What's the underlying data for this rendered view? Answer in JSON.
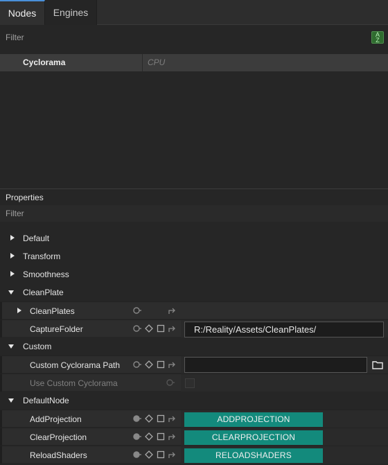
{
  "tabs": [
    {
      "label": "Nodes",
      "active": true
    },
    {
      "label": "Engines",
      "active": false
    }
  ],
  "nodes_filter": {
    "placeholder": "Filter"
  },
  "sort_icon": {
    "top": "A",
    "bottom": "Z"
  },
  "nodes": [
    {
      "name": "Cyclorama",
      "device": "CPU"
    }
  ],
  "properties": {
    "title": "Properties",
    "filter_placeholder": "Filter",
    "items": [
      {
        "label": "Default",
        "state": "collapsed"
      },
      {
        "label": "Transform",
        "state": "collapsed"
      },
      {
        "label": "Smoothness",
        "state": "collapsed"
      },
      {
        "label": "CleanPlate",
        "state": "expanded"
      },
      {
        "label": "CleanPlates",
        "state": "collapsed"
      },
      {
        "label": "CaptureFolder",
        "value": "R:/Reality/Assets/CleanPlates/"
      },
      {
        "label": "Custom",
        "state": "expanded"
      },
      {
        "label": "Custom Cyclorama Path",
        "value": ""
      },
      {
        "label": "Use Custom Cyclorama",
        "enabled": false,
        "checked": false
      },
      {
        "label": "DefaultNode",
        "state": "expanded"
      },
      {
        "label": "AddProjection",
        "button": "ADDPROJECTION"
      },
      {
        "label": "ClearProjection",
        "button": "CLEARPROJECTION"
      },
      {
        "label": "ReloadShaders",
        "button": "RELOADSHADERS"
      }
    ]
  },
  "colors": {
    "accent": "#4a90d9",
    "action_button": "#138a7c",
    "sort_button": "#2f6b2f"
  }
}
